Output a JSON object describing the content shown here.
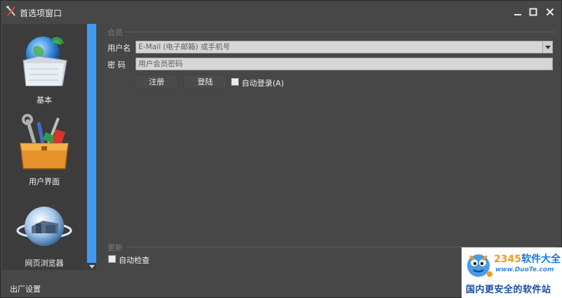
{
  "window": {
    "title": "首选项窗口",
    "accent_color": "#3f9bf0"
  },
  "sidebar": {
    "items": [
      {
        "label": "基本",
        "icon": "folder-globe-icon"
      },
      {
        "label": "用户界面",
        "icon": "toolbox-icon"
      },
      {
        "label": "网页浏览器",
        "icon": "globe-browser-icon"
      }
    ]
  },
  "member": {
    "section_title": "会员",
    "username_label": "用户名",
    "username_placeholder": "E-Mail (电子邮箱) 或手机号",
    "password_label": "密  码",
    "password_placeholder": "用户会员密码",
    "register_button": "注册",
    "login_button": "登陆",
    "auto_login_label": "自动登录(A)",
    "auto_login_checked": false
  },
  "update": {
    "section_title": "更新",
    "auto_check_label": "自动检查",
    "auto_check_checked": false
  },
  "footer": {
    "factory_settings": "出厂设置"
  },
  "watermark": {
    "brand_prefix": "2345",
    "brand_suffix": "软件大全",
    "url": "www.DuoTe.com",
    "slogan": "国内更安全的软件站"
  }
}
